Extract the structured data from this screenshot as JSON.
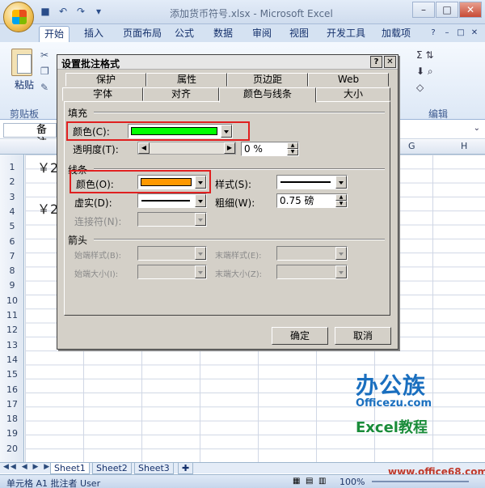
{
  "window": {
    "title": "添加货币符号.xlsx - Microsoft Excel"
  },
  "ribbon": {
    "tabs": [
      "开始",
      "插入",
      "页面布局",
      "公式",
      "数据",
      "审阅",
      "视图",
      "开发工具",
      "加载项"
    ],
    "paste_label": "粘贴",
    "clipboard_label": "剪贴板",
    "editing_label": "编辑",
    "sum_symbol": "Σ"
  },
  "formula_bar": {
    "name_box": "备注"
  },
  "grid": {
    "columns": [
      "G",
      "H"
    ],
    "rows": [
      "1",
      "2",
      "3",
      "4",
      "5",
      "6",
      "7",
      "8",
      "9",
      "10",
      "11",
      "12",
      "13",
      "14",
      "15",
      "16",
      "17",
      "18",
      "19",
      "20"
    ],
    "yen_cells": [
      "￥2",
      "￥2"
    ]
  },
  "watermark": {
    "brand": "办公族",
    "site": "Officezu.com",
    "course": "Excel教程",
    "site2": "www.office68.com"
  },
  "sheets": [
    "Sheet1",
    "Sheet2",
    "Sheet3"
  ],
  "status": {
    "text": "单元格 A1 批注者 User",
    "zoom": "100%"
  },
  "dialog": {
    "title": "设置批注格式",
    "tabs_row1": [
      "保护",
      "属性",
      "页边距",
      "Web"
    ],
    "tabs_row2": [
      "字体",
      "对齐",
      "颜色与线条",
      "大小"
    ],
    "fill": {
      "section": "填充",
      "color_label": "颜色(C):",
      "color_value": "#00ff00",
      "transparency_label": "透明度(T):",
      "transparency_value": "0 %"
    },
    "line": {
      "section": "线条",
      "color_label": "颜色(O):",
      "color_value": "#ff9900",
      "style_label": "样式(S):",
      "dash_label": "虚实(D):",
      "weight_label": "粗细(W):",
      "weight_value": "0.75 磅",
      "connector_label": "连接符(N):"
    },
    "arrows": {
      "section": "箭头",
      "begin_style": "始端样式(B):",
      "end_style": "末端样式(E):",
      "begin_size": "始端大小(I):",
      "end_size": "末端大小(Z):"
    },
    "ok": "确定",
    "cancel": "取消"
  }
}
